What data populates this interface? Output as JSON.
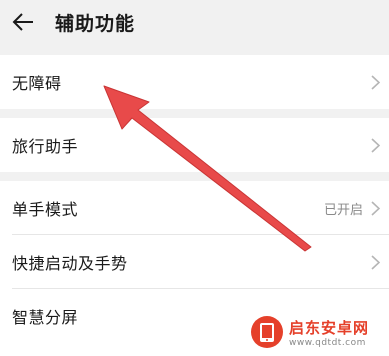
{
  "header": {
    "title": "辅助功能",
    "back_icon": "arrow-left-icon"
  },
  "groups": [
    {
      "items": [
        {
          "label": "无障碍",
          "value": ""
        }
      ]
    },
    {
      "items": [
        {
          "label": "旅行助手",
          "value": ""
        }
      ]
    },
    {
      "items": [
        {
          "label": "单手模式",
          "value": "已开启"
        },
        {
          "label": "快捷启动及手势",
          "value": ""
        },
        {
          "label": "智慧分屏",
          "value": ""
        }
      ]
    }
  ],
  "annotation": {
    "color": "#e84a4a",
    "points_to": "无障碍"
  },
  "watermark": {
    "title": "启东安卓网",
    "url": "www.qdtdt.com",
    "logo_color": "#e5402a"
  },
  "colors": {
    "background": "#f1f1f1",
    "card": "#ffffff",
    "chevron": "#b5b5b5"
  }
}
